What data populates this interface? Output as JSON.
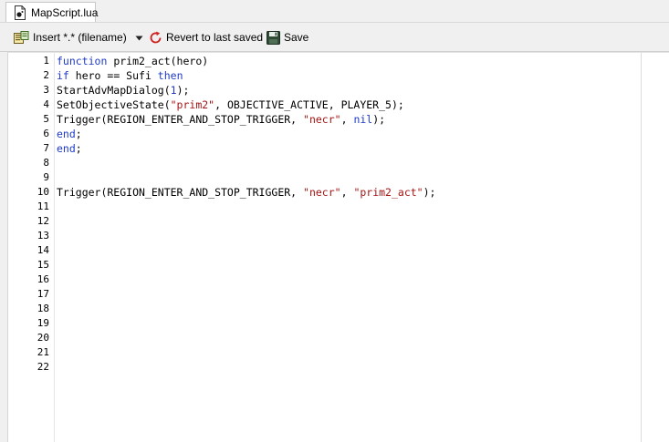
{
  "tab": {
    "title": "MapScript.lua"
  },
  "toolbar": {
    "insert_label": "Insert *.* (filename)",
    "revert_label": "Revert to last saved",
    "save_label": "Save"
  },
  "editor": {
    "line_numbers": [
      "1",
      "2",
      "3",
      "4",
      "5",
      "6",
      "7",
      "8",
      "9",
      "10",
      "11",
      "12",
      "13",
      "14",
      "15",
      "16",
      "17",
      "18",
      "19",
      "20",
      "21",
      "22"
    ],
    "lines": [
      [
        {
          "t": "function",
          "c": "kw"
        },
        {
          "t": " prim2_act(hero)",
          "c": ""
        }
      ],
      [
        {
          "t": "if",
          "c": "kw"
        },
        {
          "t": " hero == Sufi ",
          "c": ""
        },
        {
          "t": "then",
          "c": "kw"
        }
      ],
      [
        {
          "t": "StartAdvMapDialog(",
          "c": ""
        },
        {
          "t": "1",
          "c": "num"
        },
        {
          "t": ");",
          "c": ""
        }
      ],
      [
        {
          "t": "SetObjectiveState(",
          "c": ""
        },
        {
          "t": "\"prim2\"",
          "c": "str"
        },
        {
          "t": ", OBJECTIVE_ACTIVE, PLAYER_5);",
          "c": ""
        }
      ],
      [
        {
          "t": "Trigger(REGION_ENTER_AND_STOP_TRIGGER, ",
          "c": ""
        },
        {
          "t": "\"necr\"",
          "c": "str"
        },
        {
          "t": ", ",
          "c": ""
        },
        {
          "t": "nil",
          "c": "kw"
        },
        {
          "t": ");",
          "c": ""
        }
      ],
      [
        {
          "t": "end",
          "c": "kw"
        },
        {
          "t": ";",
          "c": ""
        }
      ],
      [
        {
          "t": "end",
          "c": "kw"
        },
        {
          "t": ";",
          "c": ""
        }
      ],
      [],
      [],
      [
        {
          "t": "Trigger(REGION_ENTER_AND_STOP_TRIGGER, ",
          "c": ""
        },
        {
          "t": "\"necr\"",
          "c": "str"
        },
        {
          "t": ", ",
          "c": ""
        },
        {
          "t": "\"prim2_act\"",
          "c": "str"
        },
        {
          "t": ");",
          "c": ""
        }
      ],
      [],
      [],
      [],
      [],
      [],
      [],
      [],
      [],
      [],
      [],
      [],
      []
    ]
  }
}
